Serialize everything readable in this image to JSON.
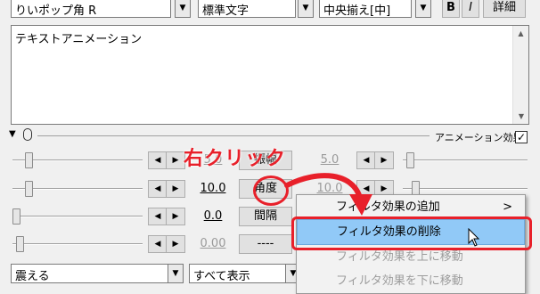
{
  "toolbar": {
    "font_value": "りいポップ角 R",
    "style_value": "標準文字",
    "align_value": "中央揃え[中]",
    "bold_label": "B",
    "italic_label": "I",
    "detail_label": "詳細"
  },
  "text_editor": {
    "value": "テキストアニメーション"
  },
  "effect_header": {
    "title": "アニメーション効果",
    "checked": true
  },
  "param_rows": [
    {
      "value": "5.0",
      "label": "振幅",
      "right_value": "5.0",
      "dim": true
    },
    {
      "value": "10.0",
      "label": "角度",
      "right_value": "10.0",
      "dim": false
    },
    {
      "value": "0.0",
      "label": "間隔",
      "right_value": "",
      "dim": false
    },
    {
      "value": "0.00",
      "label": "----",
      "right_value": "",
      "dim": true
    }
  ],
  "bottom": {
    "effect_select": "震える",
    "display_select": "すべて表示"
  },
  "annotation": {
    "text": "右クリック",
    "color": "#e8202a"
  },
  "context_menu": {
    "items": [
      {
        "label": "フィルタ効果の追加",
        "has_submenu": true,
        "submenu_glyph": ">",
        "state": "normal"
      },
      {
        "label": "フィルタ効果の削除",
        "has_submenu": false,
        "state": "highlighted"
      },
      {
        "label": "フィルタ効果を上に移動",
        "has_submenu": false,
        "state": "disabled"
      },
      {
        "label": "フィルタ効果を下に移動",
        "has_submenu": false,
        "state": "disabled"
      }
    ]
  },
  "icons": {
    "combo_arrow": "▼",
    "spin_left": "◀",
    "spin_right": "▶",
    "scroll_up": "▲",
    "scroll_down": "▼",
    "collapse": "▼"
  },
  "colors": {
    "highlight": "#91c9f7",
    "annotation_red": "#e8202a"
  }
}
